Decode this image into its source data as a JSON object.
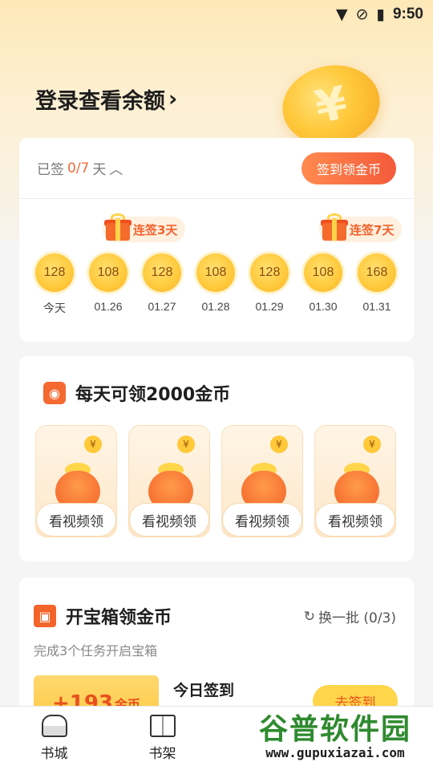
{
  "status_bar": {
    "time": "9:50"
  },
  "header": {
    "login_text": "登录查看余额"
  },
  "signin": {
    "signed_prefix": "已签",
    "signed_count": "0/7",
    "signed_suffix": "天",
    "button_label": "签到领金币",
    "streak_3": "连签3天",
    "streak_7": "连签7天",
    "days": [
      {
        "coins": "128",
        "label": "今天"
      },
      {
        "coins": "108",
        "label": "01.26"
      },
      {
        "coins": "128",
        "label": "01.27"
      },
      {
        "coins": "108",
        "label": "01.28"
      },
      {
        "coins": "128",
        "label": "01.29"
      },
      {
        "coins": "108",
        "label": "01.30"
      },
      {
        "coins": "168",
        "label": "01.31"
      }
    ]
  },
  "daily": {
    "title": "每天可领2000金币",
    "tiles": [
      "看视频领",
      "看视频领",
      "看视频领",
      "看视频领"
    ]
  },
  "treasure": {
    "title": "开宝箱领金币",
    "refresh_label": "换一批 (0/3)",
    "subtitle": "完成3个任务开启宝箱",
    "reward_amount": "+193",
    "reward_unit": "金币",
    "task_name": "今日签到",
    "go_label": "去签到"
  },
  "nav": {
    "items": [
      "书城",
      "书架"
    ]
  },
  "watermark": {
    "big": "谷普软件园",
    "small": "www.gupuxiazai.com"
  }
}
